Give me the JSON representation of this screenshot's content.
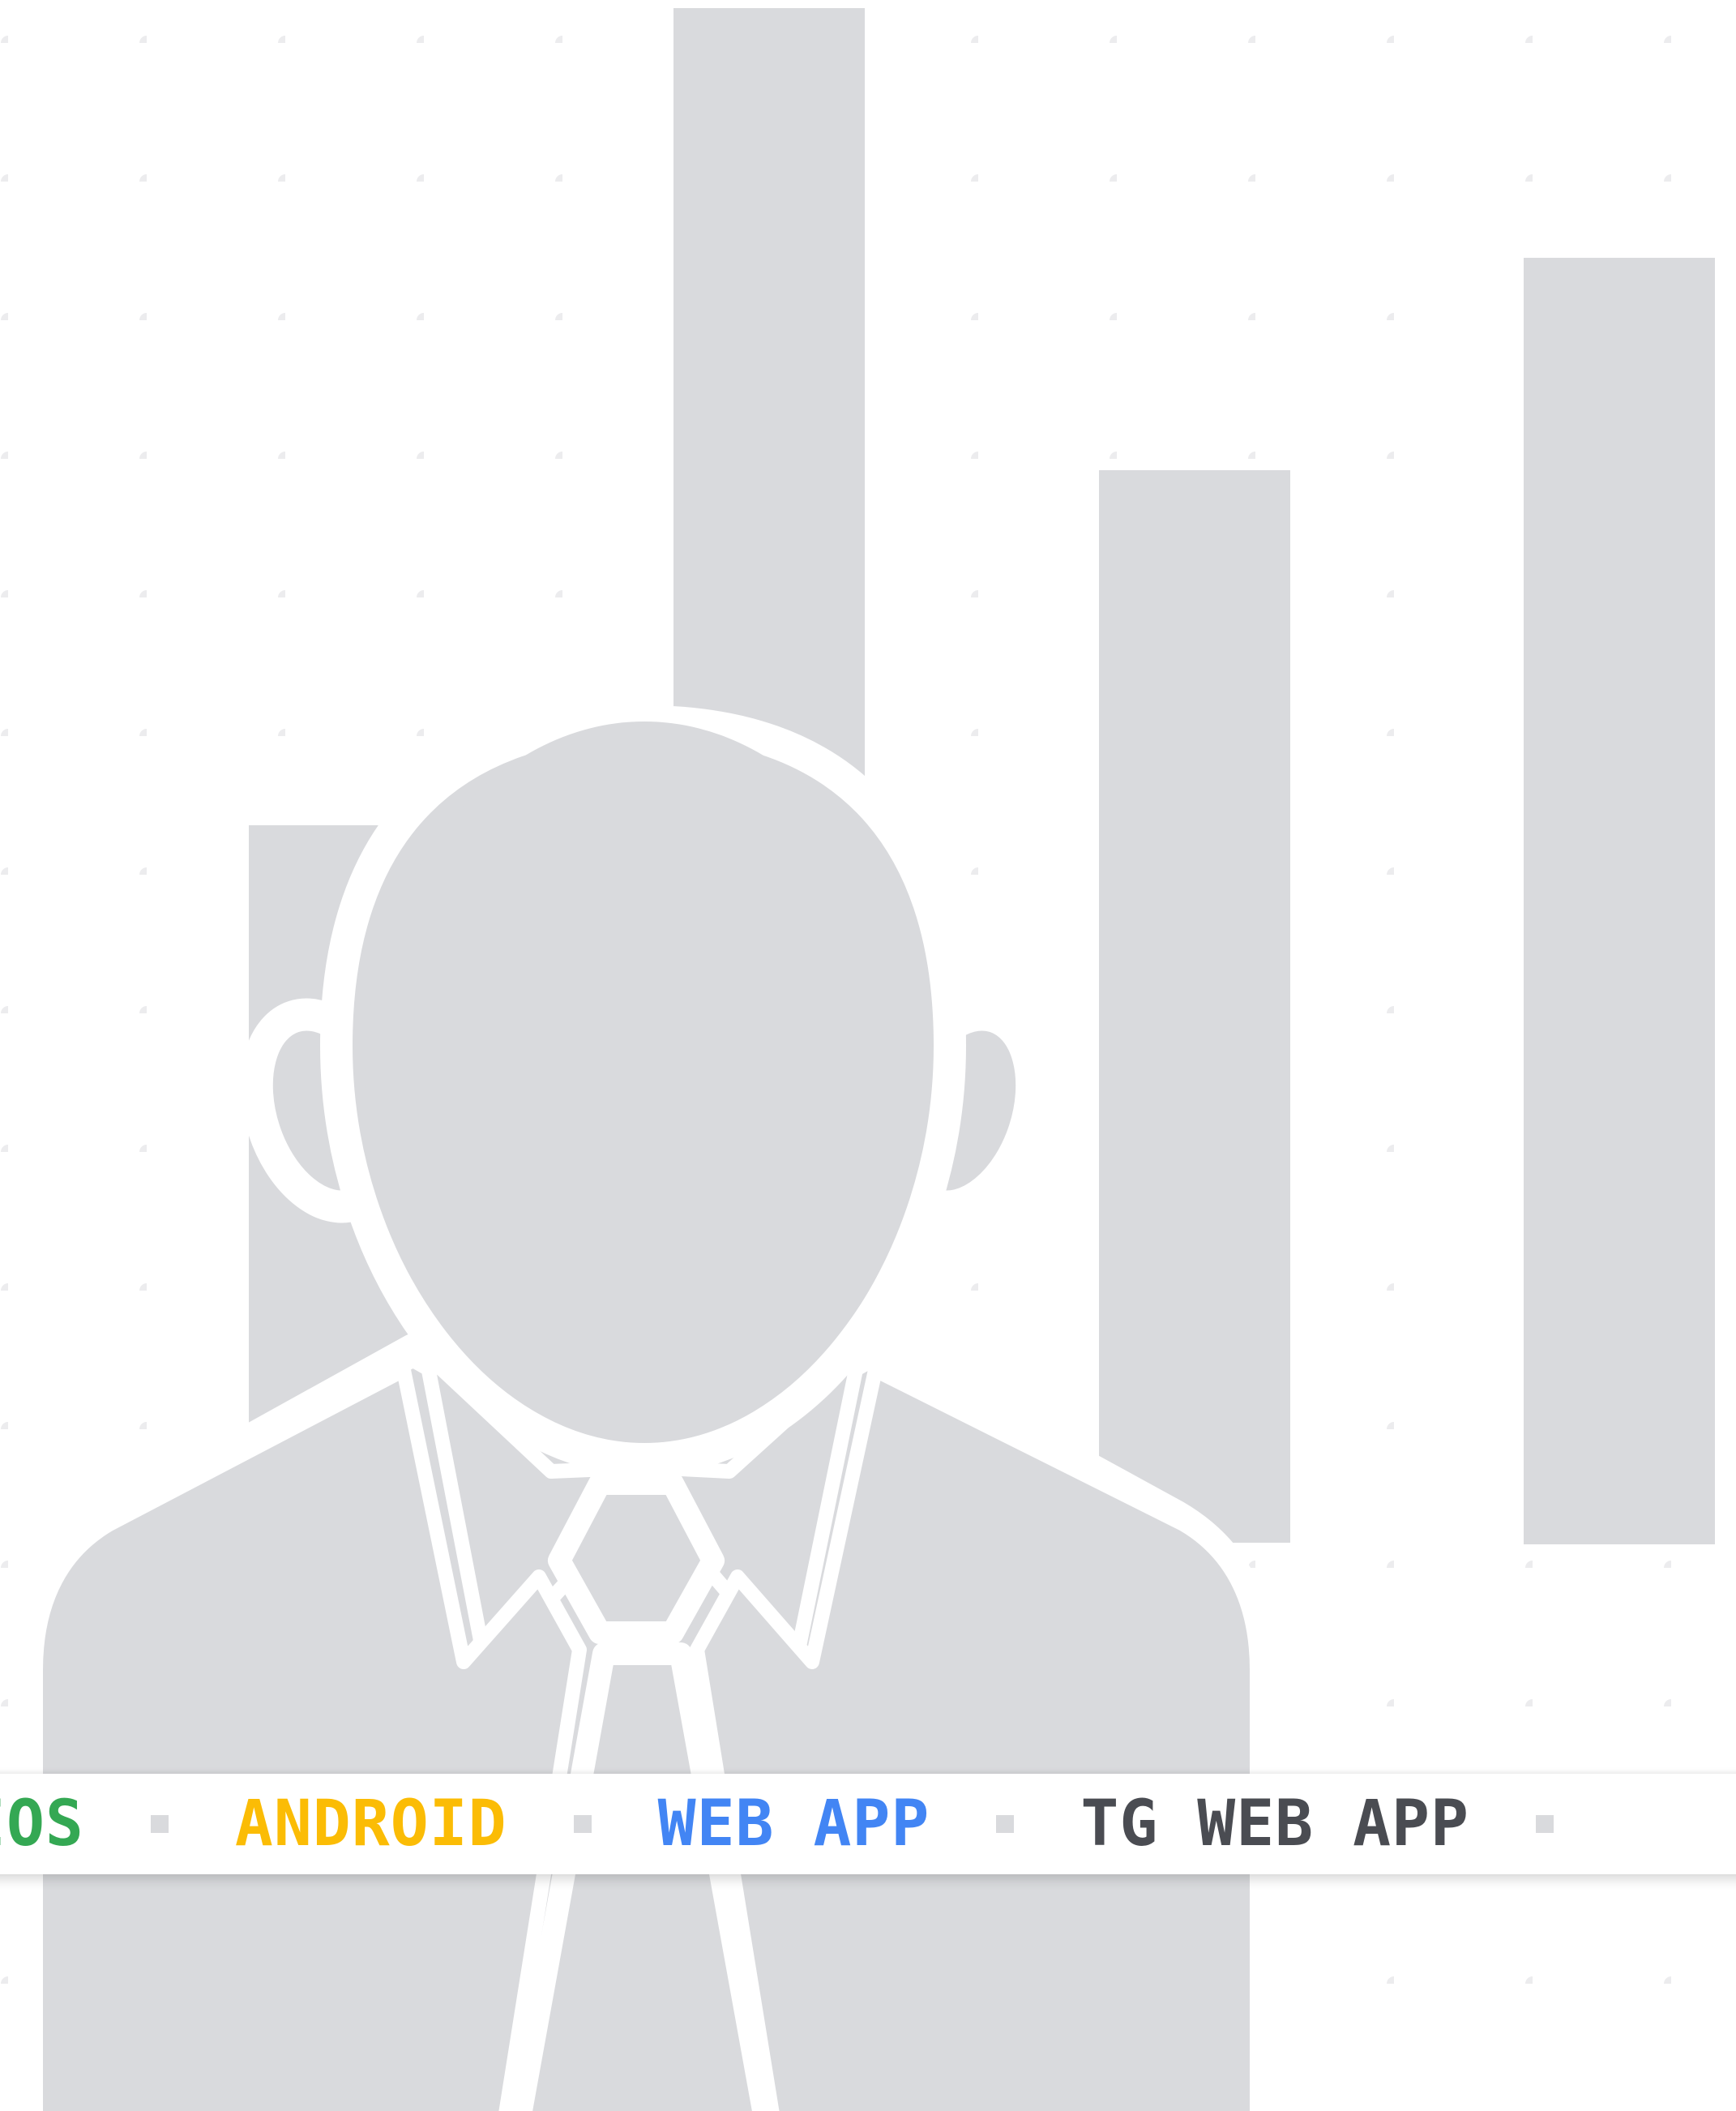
{
  "colors": {
    "background": "#ffffff",
    "dot_grid": "#ececee",
    "bars": "#d9dadd",
    "figure": "#d9dadd",
    "outline": "#ffffff"
  },
  "icons": [
    "businessman-silhouette-icon",
    "bar-chart-icon",
    "dot-grid-pattern"
  ],
  "ticker": {
    "items": [
      {
        "label": "IOS",
        "color": "#34a853"
      },
      {
        "label": "ANDROID",
        "color": "#fbbc05"
      },
      {
        "label": "WEB APP",
        "color": "#4285f4"
      },
      {
        "label": "TG WEB APP",
        "color": "#4a4c52"
      }
    ]
  }
}
